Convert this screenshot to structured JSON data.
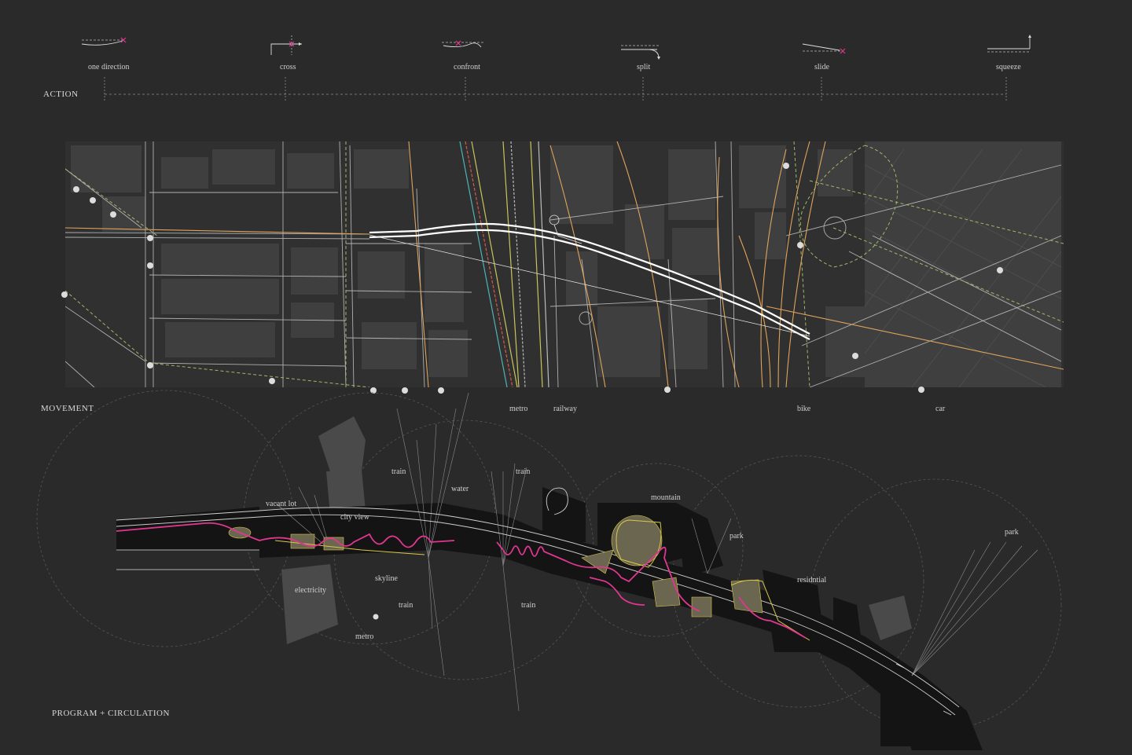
{
  "sections": {
    "action": "ACTION",
    "movement": "MOVEMENT",
    "program": "PROGRAM + CIRCULATION"
  },
  "actions": [
    {
      "label": "one direction",
      "icon": "one-direction-icon"
    },
    {
      "label": "cross",
      "icon": "cross-icon"
    },
    {
      "label": "confront",
      "icon": "confront-icon"
    },
    {
      "label": "split",
      "icon": "split-icon"
    },
    {
      "label": "slide",
      "icon": "slide-icon"
    },
    {
      "label": "squeeze",
      "icon": "squeeze-icon"
    }
  ],
  "movement_labels": {
    "metro": "metro",
    "railway": "railway",
    "bike": "bike",
    "car": "car"
  },
  "program_labels": {
    "vacant_lot": "vacant lot",
    "city_view": "city view",
    "train_1": "train",
    "water": "water",
    "train_2": "train",
    "mountain": "mountain",
    "park_1": "park",
    "park_2": "park",
    "residential": "residntial",
    "electricity": "electricity",
    "skyline": "skyline",
    "train_3": "train",
    "train_4": "train",
    "metro": "metro"
  },
  "colors": {
    "background": "#2b2a2b",
    "accent": "#e0368f",
    "path": "#ffffff",
    "metro": "#4fb3b5",
    "railway": "#c9c45a",
    "road": "#e0a35a",
    "bike": "#9fb86a",
    "program_yellow": "#d9c84a"
  }
}
